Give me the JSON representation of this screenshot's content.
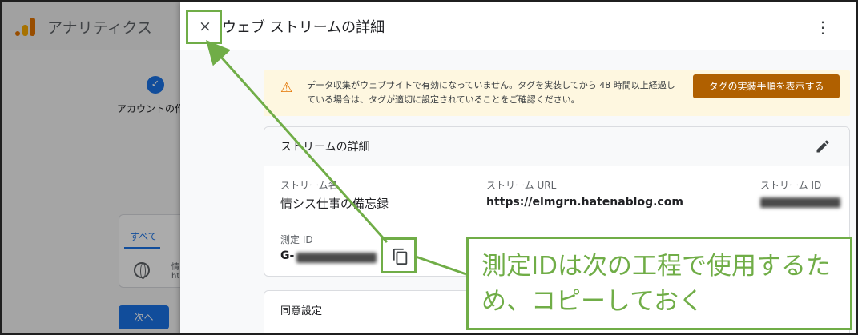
{
  "app": {
    "title": "アナリティクス"
  },
  "background": {
    "step_label": "アカウントの作",
    "tab_all": "すべて",
    "item_char": "情",
    "item_sub": "ht",
    "next_button": "次へ"
  },
  "panel": {
    "title": "ウェブ ストリームの詳細",
    "close_icon": "×",
    "more_icon": "⋮",
    "warning": {
      "text": "データ収集がウェブサイトで有効になっていません。タグを実装してから 48 時間以上経過している場合は、タグが適切に設定されていることをご確認ください。",
      "button": "タグの実装手順を表示する",
      "icon": "⚠"
    },
    "stream_details": {
      "title": "ストリームの詳細",
      "stream_name_label": "ストリーム名",
      "stream_name": "情シス仕事の備忘録",
      "stream_url_label": "ストリーム URL",
      "stream_url": "https://elmgrn.hatenablog.com",
      "stream_id_label": "ストリーム ID",
      "measurement_id_label": "測定 ID",
      "measurement_id_prefix": "G-"
    },
    "consent": {
      "title": "同意設定"
    }
  },
  "annotation": {
    "text": "測定IDは次の工程で使用するため、コピーしておく",
    "color": "#70ad47"
  }
}
